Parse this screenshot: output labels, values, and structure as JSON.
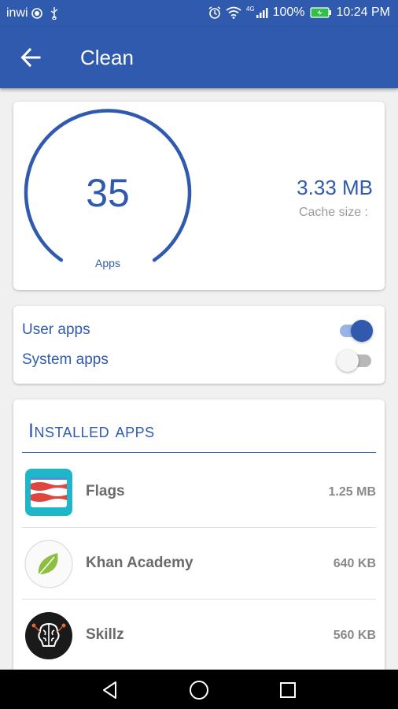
{
  "status_bar": {
    "carrier": "inwi",
    "network": "4G",
    "battery": "100%",
    "time": "10:24 PM",
    "icons": [
      "record-icon",
      "usb-icon",
      "alarm-icon",
      "wifi-icon",
      "signal-icon",
      "battery-icon"
    ]
  },
  "app_bar": {
    "title": "Clean",
    "back_icon": "arrow-back-icon"
  },
  "summary": {
    "app_count": "35",
    "apps_label": "Apps",
    "cache_size": "3.33 MB",
    "cache_label": "Cache size :"
  },
  "filters": {
    "user_apps": {
      "label": "User apps",
      "enabled": true
    },
    "system_apps": {
      "label": "System apps",
      "enabled": false
    }
  },
  "installed": {
    "title": "Installed apps",
    "apps": [
      {
        "name": "Flags",
        "size": "1.25 MB",
        "icon": "flag-app-icon"
      },
      {
        "name": "Khan Academy",
        "size": "640 KB",
        "icon": "leaf-app-icon"
      },
      {
        "name": "Skillz",
        "size": "560 KB",
        "icon": "brain-app-icon"
      }
    ]
  },
  "nav": {
    "back": "nav-back-icon",
    "home": "nav-home-icon",
    "recents": "nav-recents-icon"
  },
  "colors": {
    "primary": "#2f5aae",
    "background": "#f0f0f0"
  }
}
